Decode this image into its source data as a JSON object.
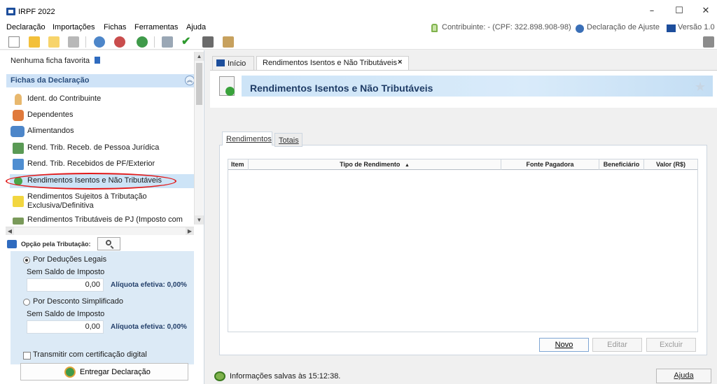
{
  "window": {
    "title": "IRPF 2022",
    "controls": {
      "minimize": "–",
      "maximize": "☐",
      "close": "✕"
    }
  },
  "menu": {
    "items": [
      "Declaração",
      "Importações",
      "Fichas",
      "Ferramentas",
      "Ajuda"
    ],
    "contribuinte": "Contribuinte: - (CPF: 322.898.908-98)",
    "declaracao": "Declaração de Ajuste",
    "versao": "Versão 1.0"
  },
  "toolbar": {
    "icons": [
      "new-file-icon",
      "open-folder-icon",
      "folder-icon",
      "trash-icon",
      "import-icon",
      "recover-icon",
      "globe-icon",
      "print-icon",
      "check-icon",
      "calculator-icon",
      "report-icon"
    ],
    "exit_icon": "exit-icon"
  },
  "sidebar": {
    "favorite_label": "Nenhuma ficha favorita",
    "section_title": "Fichas da Declaração",
    "items": [
      {
        "label": "Ident. do Contribuinte",
        "icon": "person-icon"
      },
      {
        "label": "Dependentes",
        "icon": "dependents-icon"
      },
      {
        "label": "Alimentandos",
        "icon": "alimentandos-icon"
      },
      {
        "label": "Rend. Trib. Receb. de Pessoa Jurídica",
        "icon": "income-pj-icon"
      },
      {
        "label": "Rend. Trib. Recebidos de PF/Exterior",
        "icon": "income-pf-icon"
      },
      {
        "label": "Rendimentos Isentos e Não Tributáveis",
        "icon": "exempt-income-icon"
      },
      {
        "label": "Rendimentos Sujeitos à Tributação",
        "label2": "Exclusiva/Definitiva",
        "icon": "warning-doc-icon"
      },
      {
        "label": "Rendimentos Tributáveis de PJ (Imposto com",
        "icon": "pj-tax-icon"
      }
    ]
  },
  "opcao": {
    "title": "Opção pela Tributação:",
    "deducoes_label": "Por Deduções Legais",
    "deducoes_sub": "Sem Saldo de Imposto",
    "deducoes_value": "0,00",
    "deducoes_aliquota": "Alíquota efetiva: 0,00%",
    "desconto_label": "Por Desconto Simplificado",
    "desconto_sub": "Sem Saldo de Imposto",
    "desconto_value": "0,00",
    "desconto_aliquota": "Alíquota efetiva: 0,00%",
    "transmitir_label": "Transmitir com certificação digital",
    "entregar_label": "Entregar Declaração"
  },
  "tabs": {
    "inicio": "Início",
    "active": "Rendimentos Isentos e Não Tributáveis",
    "close": "×"
  },
  "banner": {
    "title": "Rendimentos Isentos e Não Tributáveis"
  },
  "inner_tabs": {
    "rendimentos": "Rendimentos",
    "totais": "Totais"
  },
  "grid": {
    "columns": [
      "Item",
      "Tipo de Rendimento",
      "Fonte Pagadora",
      "Beneficiário",
      "Valor (R$)"
    ],
    "sort_indicator": "▲",
    "rows": []
  },
  "buttons": {
    "novo": "Novo",
    "editar": "Editar",
    "excluir": "Excluir",
    "ajuda": "Ajuda"
  },
  "status": {
    "message": "Informações salvas às 15:12:38."
  },
  "colors": {
    "accent": "#1d4e9c",
    "banner": "#cde4f7",
    "highlight_oval": "#e21b1b"
  }
}
